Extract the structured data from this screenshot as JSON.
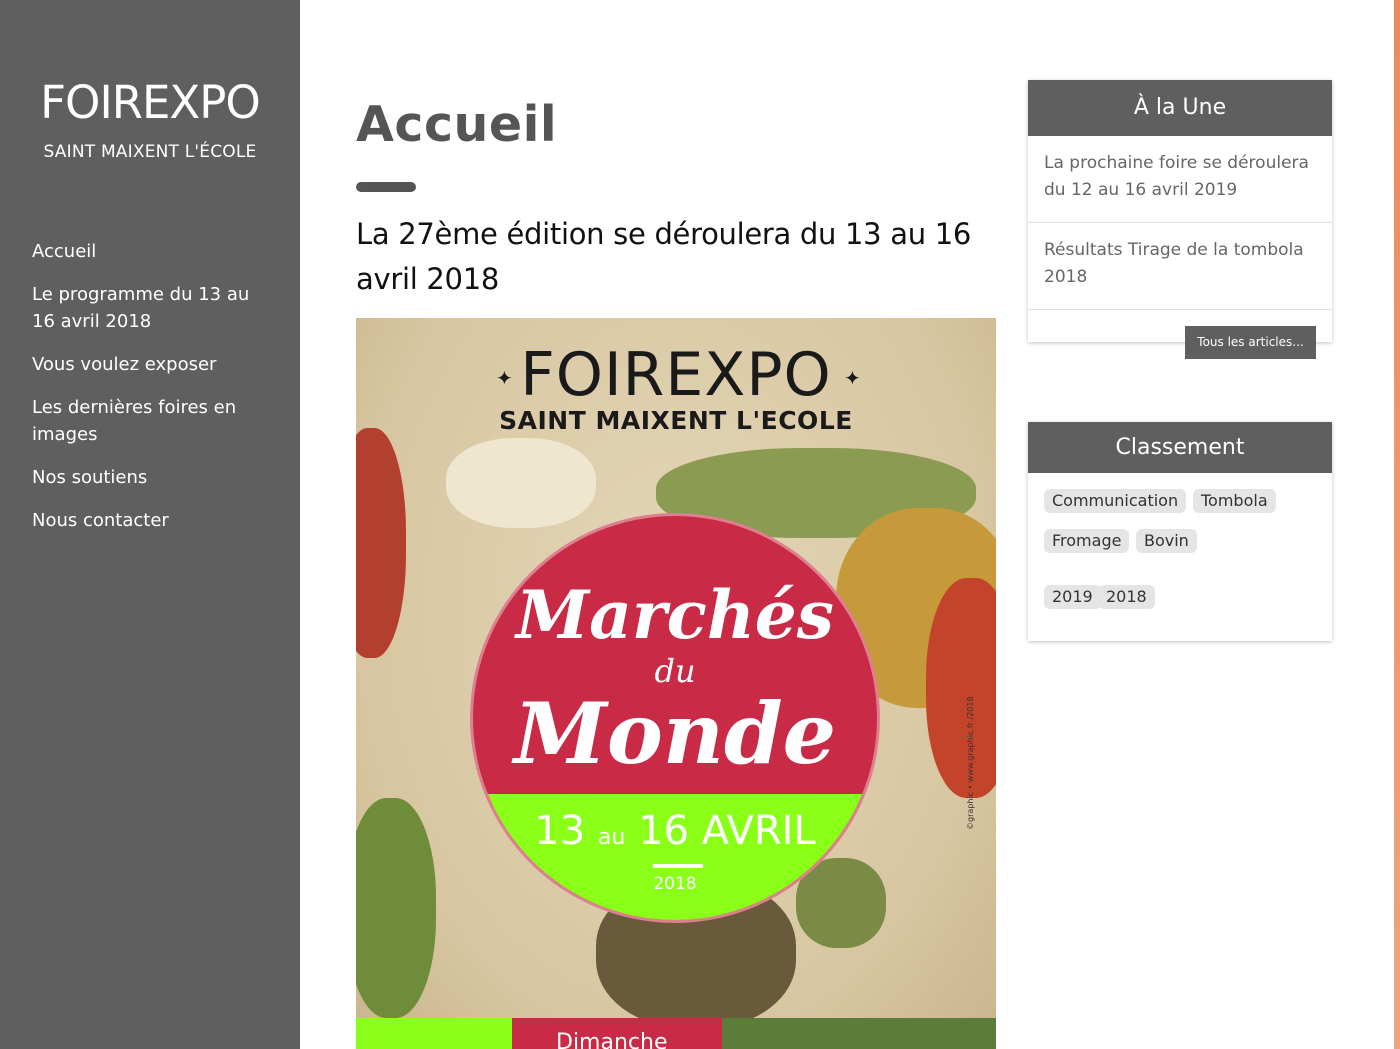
{
  "site": {
    "title": "FOIREXPO",
    "subtitle": "SAINT MAIXENT L'ÉCOLE"
  },
  "nav": [
    "Accueil",
    "Le programme du 13 au 16 avril 2018",
    "Vous voulez exposer",
    "Les dernières foires en images",
    "Nos soutiens",
    "Nous contacter"
  ],
  "main": {
    "title": "Accueil",
    "lead": "La 27ème édition se déroulera du 13 au 16 avril 2018"
  },
  "poster": {
    "title": "FOIREXPO",
    "subtitle": "SAINT MAIXENT L'ECOLE",
    "script1": "Marchés",
    "script2": "du",
    "script3": "Monde",
    "date_start": "13",
    "date_au": "au",
    "date_end": "16 AVRIL",
    "year": "2018",
    "credit": "©graphic • www.graphic.fr /2018",
    "strip_text": "Dimanche"
  },
  "widget_une": {
    "title": "À la Une",
    "items": [
      "La prochaine foire se déroulera du 12 au 16 avril 2019",
      "Résultats Tirage de la tombola 2018"
    ],
    "more": "Tous les articles..."
  },
  "widget_classement": {
    "title": "Classement",
    "tags": [
      "Communication",
      "Tombola",
      "Fromage",
      "Bovin",
      "2019",
      "2018"
    ]
  },
  "colors": {
    "sidebar": "#5f5f5f",
    "accent_edge": "#e98c5e",
    "poster_red": "#c92a46",
    "poster_green": "#8aff18"
  }
}
